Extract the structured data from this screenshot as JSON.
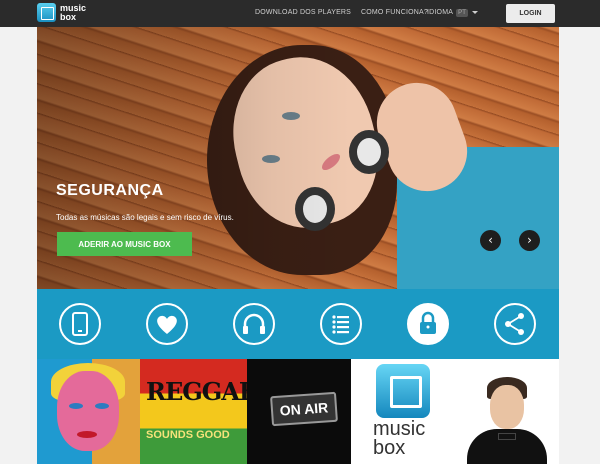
{
  "nav": {
    "brand_line1": "music",
    "brand_line2": "box",
    "links": [
      "DOWNLOAD DOS PLAYERS",
      "COMO FUNCIONA?"
    ],
    "language_label": "IDIOMA",
    "language_code": "PT",
    "login_label": "LOGIN"
  },
  "hero": {
    "title": "SEGURANÇA",
    "subtitle": "Todas as músicas são legais e sem risco de vírus.",
    "cta_label": "ADERIR AO MUSIC BOX",
    "prev_glyph": "‹",
    "next_glyph": "›"
  },
  "features": {
    "items": [
      "phone-icon",
      "heart-icon",
      "headphones-icon",
      "list-icon",
      "lock-icon",
      "share-icon"
    ],
    "active_index": 4,
    "accent_color": "#1b9ac4"
  },
  "tiles": {
    "reggae_text": "REGGAE",
    "sounds_good_text": "SOUNDS GOOD",
    "on_air_text": "ON AIR",
    "brand_line1": "music",
    "brand_line2": "box"
  },
  "colors": {
    "navbar": "#2b2b2b",
    "cta": "#4dbb4f",
    "feature_bar": "#1b9ac4"
  }
}
